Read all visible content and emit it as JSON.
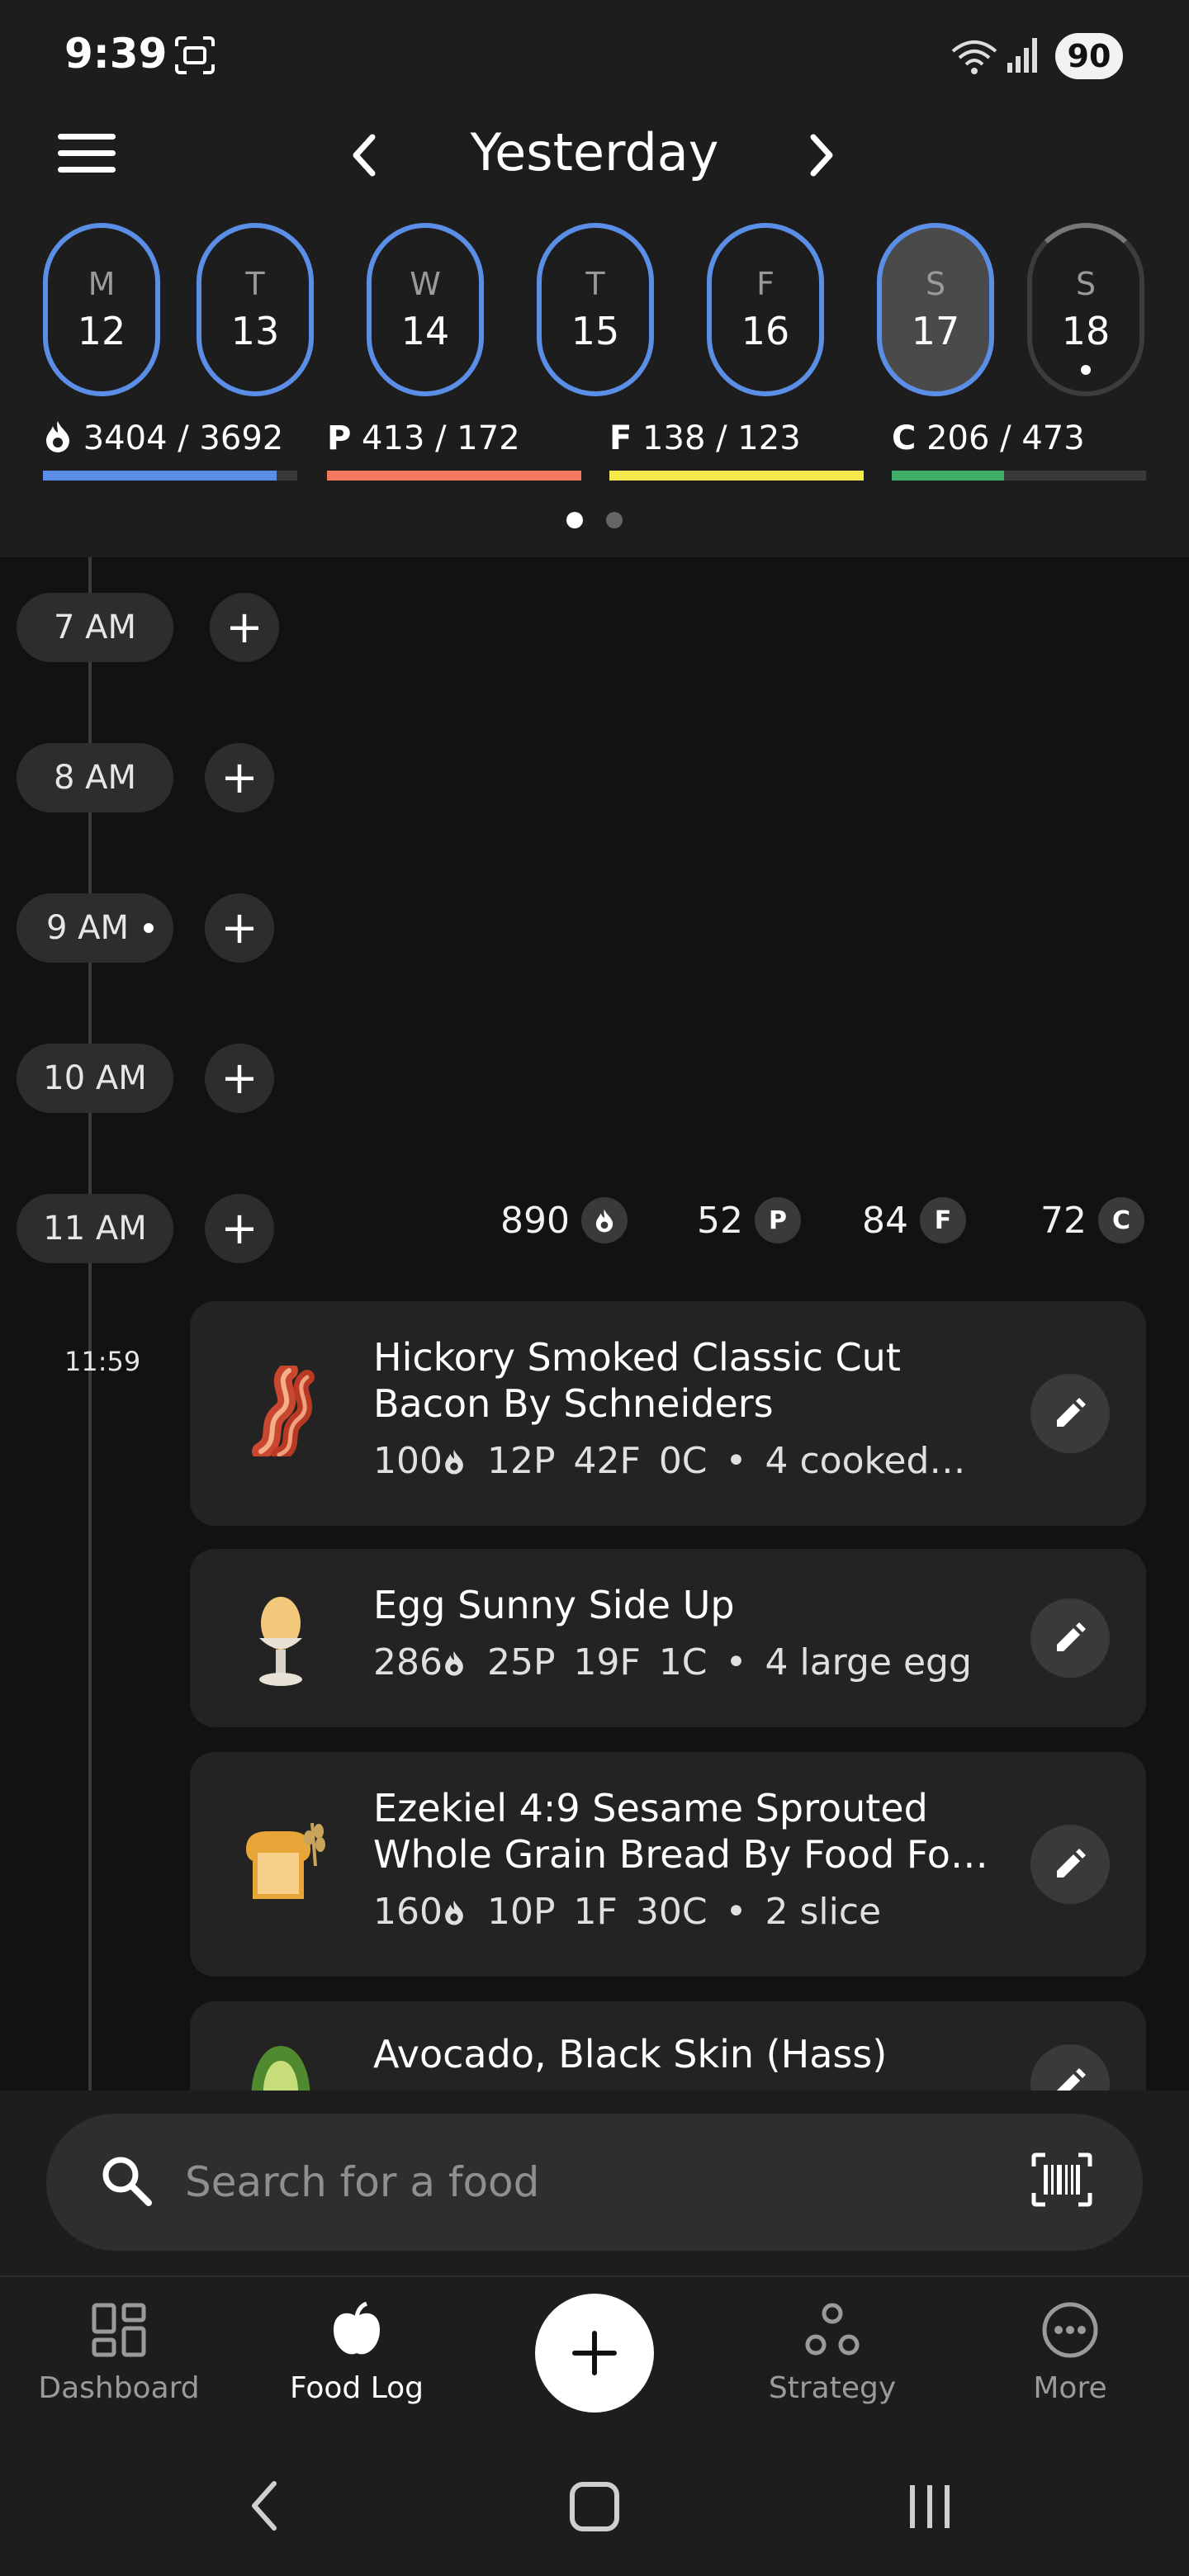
{
  "status": {
    "time": "9:39",
    "battery": "90"
  },
  "header": {
    "title": "Yesterday"
  },
  "days": [
    {
      "letter": "M",
      "num": "12"
    },
    {
      "letter": "T",
      "num": "13"
    },
    {
      "letter": "W",
      "num": "14"
    },
    {
      "letter": "T",
      "num": "15"
    },
    {
      "letter": "F",
      "num": "16"
    },
    {
      "letter": "S",
      "num": "17",
      "selected": true
    },
    {
      "letter": "S",
      "num": "18",
      "today": true
    }
  ],
  "macros": [
    {
      "key": "",
      "text": "3404 / 3692",
      "color": "#5b8ee6",
      "progress": 0.92
    },
    {
      "key": "P",
      "text": "413 / 172",
      "color": "#f27a5e",
      "progress": 1.0
    },
    {
      "key": "F",
      "text": "138 / 123",
      "color": "#f5e84a",
      "progress": 1.0
    },
    {
      "key": "C",
      "text": "206 / 473",
      "color": "#3fae6a",
      "progress": 0.44
    }
  ],
  "timeline": {
    "hours": [
      "7 AM",
      "8 AM",
      "9 AM",
      "10 AM",
      "11 AM"
    ],
    "totals": {
      "cal": "890",
      "p": "52",
      "f": "84",
      "c": "72",
      "p_key": "P",
      "f_key": "F",
      "c_key": "C"
    },
    "entry_time": "11:59"
  },
  "foods": [
    {
      "name": "Hickory Smoked Classic Cut Bacon By Schneiders",
      "cal": "100",
      "p": "12P",
      "f": "42F",
      "c": "0C",
      "serving": "4 cooked…",
      "icon": "bacon-icon"
    },
    {
      "name": "Egg Sunny Side Up",
      "cal": "286",
      "p": "25P",
      "f": "19F",
      "c": "1C",
      "serving": "4 large egg",
      "icon": "egg-icon"
    },
    {
      "name": "Ezekiel 4:9 Sesame Sprouted Whole Grain Bread By Food Fo…",
      "cal": "160",
      "p": "10P",
      "f": "1F",
      "c": "30C",
      "serving": "2 slice",
      "icon": "bread-icon"
    },
    {
      "name": "Avocado, Black Skin (Hass)",
      "icon": "avocado-icon"
    }
  ],
  "search": {
    "placeholder": "Search for a food"
  },
  "nav": {
    "dashboard": "Dashboard",
    "foodlog": "Food Log",
    "strategy": "Strategy",
    "more": "More"
  }
}
